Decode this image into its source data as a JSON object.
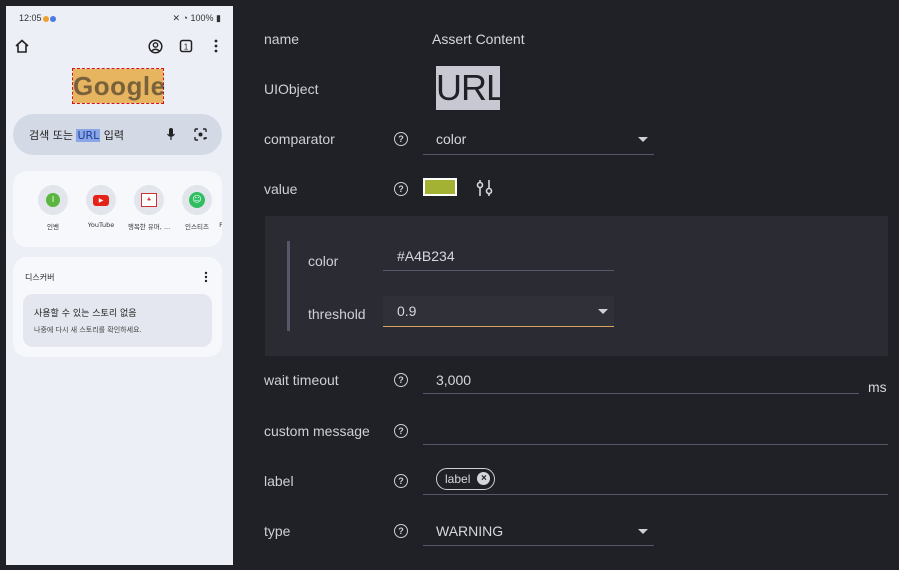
{
  "phone": {
    "status": {
      "time": "12:05",
      "battery": "100%"
    },
    "search": {
      "before": "검색 또는 ",
      "highlight": "URL",
      "after": " 입력"
    },
    "google_logo_text": "Google",
    "shortcuts": [
      {
        "label": "인벤",
        "icon": "inven-icon"
      },
      {
        "label": "YouTube",
        "icon": "youtube-icon"
      },
      {
        "label": "행복한 유머, ...",
        "icon": "humor-site-icon"
      },
      {
        "label": "인스티즈",
        "icon": "instiz-icon"
      },
      {
        "label": "F",
        "icon": "partial-shortcut-icon"
      }
    ],
    "discover": {
      "title": "디스커버",
      "story_title": "사용할 수 있는 스토리 없음",
      "story_sub": "나중에 다시 새 스토리를 확인하세요."
    }
  },
  "form": {
    "name": {
      "label": "name",
      "value": "Assert Content"
    },
    "uiobject": {
      "label": "UIObject",
      "preview_text": "URL"
    },
    "comparator": {
      "label": "comparator",
      "value": "color"
    },
    "value": {
      "label": "value",
      "swatch_color": "#A4B234"
    },
    "color": {
      "label": "color",
      "value": "#A4B234"
    },
    "threshold": {
      "label": "threshold",
      "value": "0.9"
    },
    "wait_timeout": {
      "label": "wait timeout",
      "value": "3,000",
      "unit": "ms"
    },
    "custom_message": {
      "label": "custom message",
      "value": ""
    },
    "label_field": {
      "label": "label",
      "chip": "label"
    },
    "type": {
      "label": "type",
      "value": "WARNING"
    }
  },
  "colors": {
    "panel_bg": "#202127",
    "accent_underline": "#d9a15a",
    "swatch": "#A4B234"
  }
}
